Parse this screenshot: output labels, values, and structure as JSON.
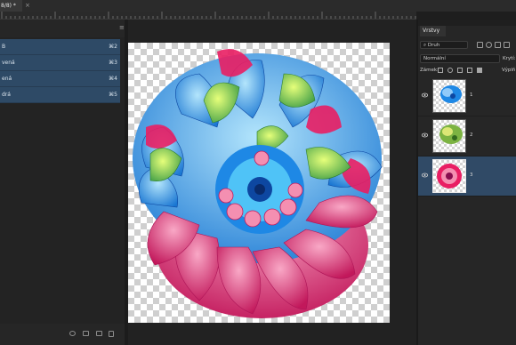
{
  "document": {
    "tab_label": "8/8) *",
    "close_glyph": "×"
  },
  "channels_panel": {
    "menu_icon": "panel-menu-icon",
    "rows": [
      {
        "label": "B",
        "shortcut": "⌘2"
      },
      {
        "label": "vená",
        "shortcut": "⌘3"
      },
      {
        "label": "ená",
        "shortcut": "⌘4"
      },
      {
        "label": "drá",
        "shortcut": "⌘5"
      }
    ],
    "footer_icons": [
      "load-selection-icon",
      "save-selection-icon",
      "new-channel-icon",
      "trash-icon"
    ]
  },
  "layers_panel": {
    "tab_label": "Vrstvy",
    "filter": {
      "value": "Druh",
      "icon": "search-icon"
    },
    "blend_mode": "Normální",
    "opacity_label": "Krytí:",
    "lock_label": "Zámek:",
    "fill_label": "Výplň:",
    "layers": [
      {
        "name": "1",
        "visible": true,
        "selected": false,
        "thumb": "blue-flower"
      },
      {
        "name": "2",
        "visible": true,
        "selected": false,
        "thumb": "green-flower"
      },
      {
        "name": "3",
        "visible": true,
        "selected": true,
        "thumb": "pink-dahlia"
      }
    ]
  },
  "colors": {
    "panel_bg": "#262626",
    "selection": "#304a66",
    "channel_row": "#2e4a66",
    "app_bg": "#1e1e1e"
  }
}
